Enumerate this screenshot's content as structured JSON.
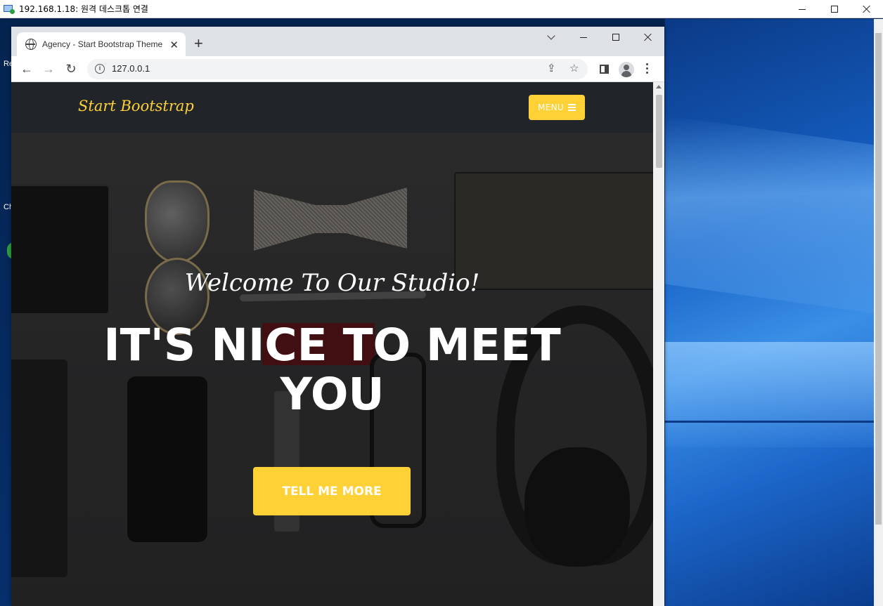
{
  "rdp": {
    "title": "192.168.1.18: 원격 데스크톱 연결"
  },
  "desktop": {
    "icon_labels": [
      "Re",
      "Ch"
    ]
  },
  "browser": {
    "tab_title": "Agency - Start Bootstrap Theme",
    "tab_close": "✕",
    "new_tab": "+",
    "url": "127.0.0.1",
    "back": "←",
    "forward": "→",
    "reload": "↻",
    "share": "⇪",
    "bookmark": "☆"
  },
  "site": {
    "brand": "Start Bootstrap",
    "menu_label": "MENU",
    "hero_subheading": "Welcome To Our Studio!",
    "hero_heading": "IT'S NICE TO MEET YOU",
    "cta_label": "TELL ME MORE",
    "accent_color": "#fed136",
    "navbar_color": "#212529"
  }
}
